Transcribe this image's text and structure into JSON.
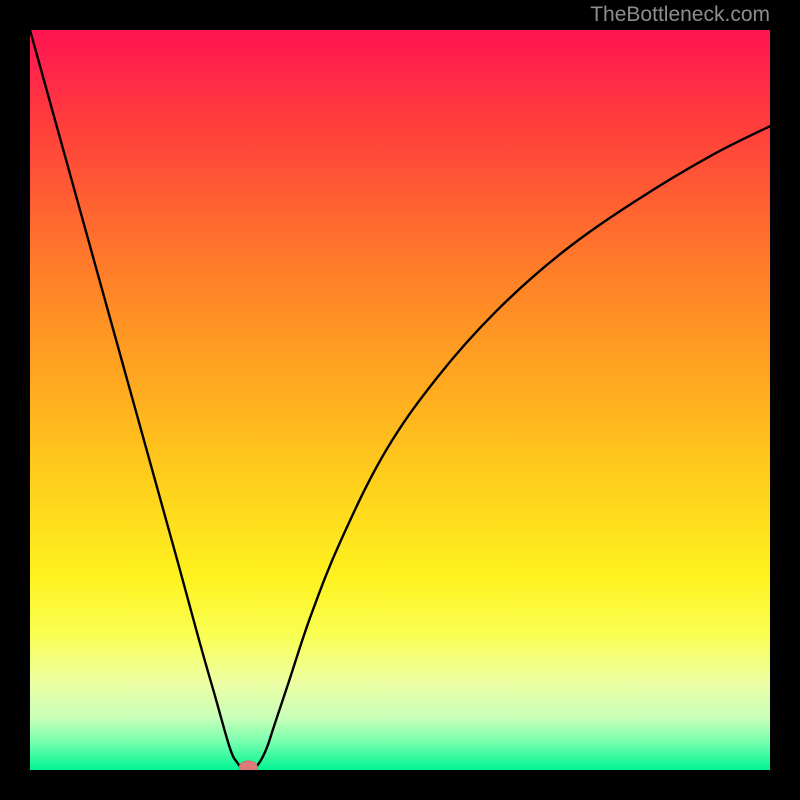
{
  "watermark": "TheBottleneck.com",
  "chart_data": {
    "type": "line",
    "title": "",
    "xlabel": "",
    "ylabel": "",
    "xlim": [
      0,
      100
    ],
    "ylim": [
      0,
      100
    ],
    "grid": false,
    "axes_visible": false,
    "background_gradient": "green-to-red (bottom-to-top)",
    "series": [
      {
        "name": "bottleneck-curve",
        "x": [
          0,
          5,
          10,
          15,
          20,
          23,
          25,
          27,
          28,
          29,
          30,
          31,
          32,
          33,
          35,
          38,
          42,
          48,
          55,
          63,
          72,
          82,
          92,
          100
        ],
        "y": [
          100,
          82,
          64,
          46,
          28,
          17,
          10,
          3,
          1,
          0,
          0,
          1,
          3,
          6,
          12,
          21,
          31,
          43,
          53,
          62,
          70,
          77,
          83,
          87
        ]
      }
    ],
    "marker": {
      "name": "optimal-point",
      "x": 29.5,
      "y": 0,
      "color": "#e07a7a"
    }
  }
}
